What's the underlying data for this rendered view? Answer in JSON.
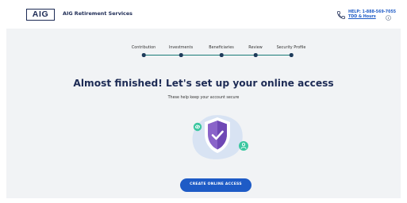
{
  "header": {
    "logo_text": "AIG",
    "brand_name": "AIG Retirement Services",
    "help_line1": "HELP: 1-888-569-7055",
    "help_line2": "TDD & Hours"
  },
  "steps": [
    {
      "label": "Contribution"
    },
    {
      "label": "Investments"
    },
    {
      "label": "Beneficiaries"
    },
    {
      "label": "Review"
    },
    {
      "label": "Security Profile"
    }
  ],
  "main": {
    "title": "Almost finished! Let's set up your online access",
    "subtitle": "These help keep your account secure",
    "cta_label": "CREATE ONLINE ACCESS"
  },
  "icons": {
    "phone": "phone-icon",
    "info": "info-icon",
    "shield": "shield-check-icon",
    "link": "link-icon",
    "user": "user-icon"
  },
  "colors": {
    "brand_navy": "#1d2b55",
    "link_blue": "#1e5bc6",
    "teal": "#1a7a78",
    "panel_bg": "#f1f3f5",
    "shield_purple": "#8a63c9",
    "badge_green": "#3cc7a0"
  }
}
